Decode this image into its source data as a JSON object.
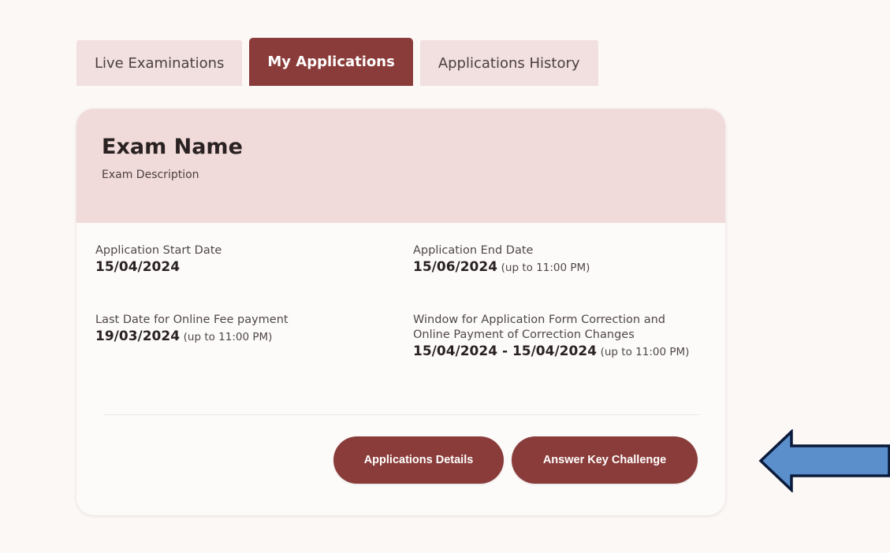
{
  "tabs": [
    {
      "label": "Live Examinations",
      "active": false
    },
    {
      "label": "My Applications",
      "active": true
    },
    {
      "label": "Applications History",
      "active": false
    }
  ],
  "card": {
    "exam_name": "Exam Name",
    "exam_description": "Exam Description",
    "fields": {
      "start": {
        "label": "Application Start Date",
        "value": "15/04/2024",
        "note": ""
      },
      "end": {
        "label": "Application End Date",
        "value": "15/06/2024",
        "note": "(up to 11:00 PM)"
      },
      "fee": {
        "label": "Last Date for Online Fee payment",
        "value": "19/03/2024",
        "note": "(up to 11:00 PM)"
      },
      "correction": {
        "label_line1": "Window for Application Form Correction and",
        "label_line2": "Online Payment of Correction Changes",
        "value": "15/04/2024 - 15/04/2024",
        "note": "(up to 11:00 PM)"
      }
    },
    "buttons": {
      "details": "Applications Details",
      "challenge": "Answer Key Challenge"
    }
  },
  "colors": {
    "accent": "#8a3c3a",
    "header_bg": "#f1dada",
    "tab_bg": "#f2dfdf",
    "arrow_fill": "#5b8fcc",
    "arrow_stroke": "#0b1a3a"
  },
  "annotation": {
    "icon": "left-arrow-icon"
  }
}
